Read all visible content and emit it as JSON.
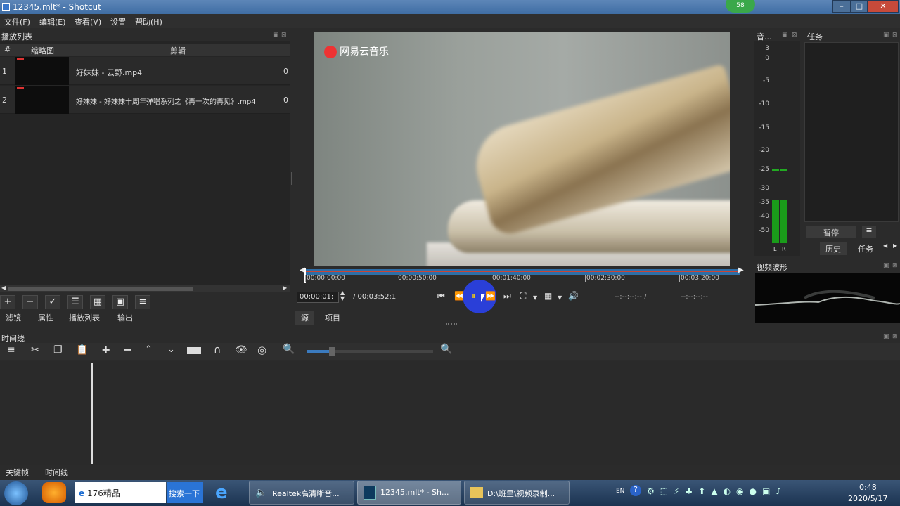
{
  "window": {
    "title": "12345.mlt* - Shotcut",
    "badge": "58"
  },
  "menu": [
    "文件(F)",
    "编辑(E)",
    "查看(V)",
    "设置",
    "帮助(H)"
  ],
  "playlist": {
    "title": "播放列表",
    "col_num": "#",
    "col_thumb": "缩略图",
    "col_clip": "剪辑",
    "rows": [
      {
        "num": "1",
        "name": "好妹妹 - 云野.mp4",
        "extra": "0"
      },
      {
        "num": "2",
        "name": "好妹妹 - 好妹妹十周年弹唱系列之《再一次的再见》.mp4",
        "extra": "0"
      }
    ]
  },
  "left_tabs": [
    "滤镜",
    "属性",
    "播放列表",
    "输出"
  ],
  "player": {
    "logo": "网易云音乐",
    "ticks": [
      "00:00:00:00",
      "00:00:50:00",
      "00:01:40:00",
      "00:02:30:00",
      "00:03:20:00"
    ],
    "current": "00:00:01:",
    "duration": "/ 00:03:52:1",
    "in_point": "--:--:--:-- /",
    "out_point": "--:--:--:--",
    "tab_source": "源",
    "tab_project": "项目"
  },
  "meter": {
    "title": "音...",
    "scale": [
      "3",
      "0",
      "-5",
      "-10",
      "-15",
      "-20",
      "-25",
      "-30",
      "-35",
      "-40",
      "-50"
    ],
    "lr": [
      "L",
      "R"
    ]
  },
  "jobs": {
    "title": "任务",
    "pause": "暂停",
    "tab_history": "历史",
    "tab_jobs": "任务"
  },
  "waveform": {
    "title": "视频波形"
  },
  "timeline": {
    "title": "时间线"
  },
  "bottom_tabs": [
    "关键帧",
    "时间线"
  ],
  "taskbar": {
    "ie_label": "176精品",
    "search": "搜索一下",
    "item_audio": "Realtek高清晰音...",
    "item_shotcut": "12345.mlt* - Sh...",
    "item_folder": "D:\\班里\\视频录制...",
    "time": "0:48",
    "date": "2020/5/17",
    "lang": "EN"
  },
  "colors": {
    "accent": "#2e6ea6",
    "meter_green": "#1a9c1a"
  }
}
